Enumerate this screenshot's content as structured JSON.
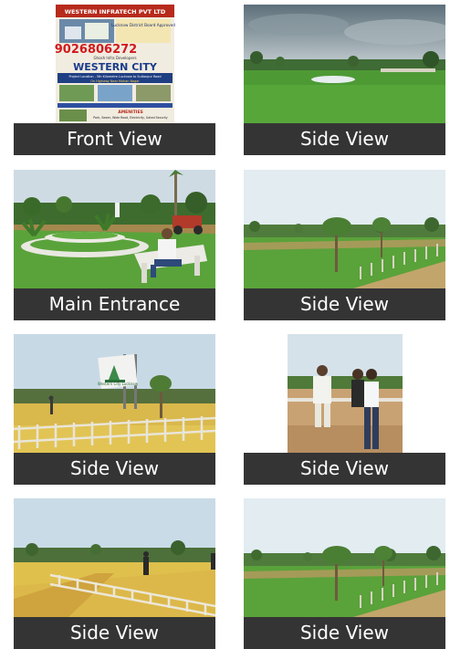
{
  "gallery": {
    "items": [
      {
        "caption": "Front View",
        "poster": {
          "brand": "WESTERN INFRATECH PVT LTD",
          "approval": "Lucknow District Board Approved",
          "phone": "9026806272",
          "presents": "Ghosh Infra Developers",
          "project": "WESTERN CITY",
          "location": "Project Location - 5th Kilometre Lucknow to Sultanpur Road",
          "tagline": "On Highway Near Mohan Nagar",
          "amenities_title": "AMENITIES",
          "amenities": "Park, Sewer, Wide Road, Electricity, Gated Security"
        }
      },
      {
        "caption": "Side View"
      },
      {
        "caption": "Main Entrance"
      },
      {
        "caption": "Side View"
      },
      {
        "caption": "Side View",
        "sign": "Western City Lucknow"
      },
      {
        "caption": "Side View"
      },
      {
        "caption": "Side View"
      },
      {
        "caption": "Side View"
      }
    ]
  }
}
